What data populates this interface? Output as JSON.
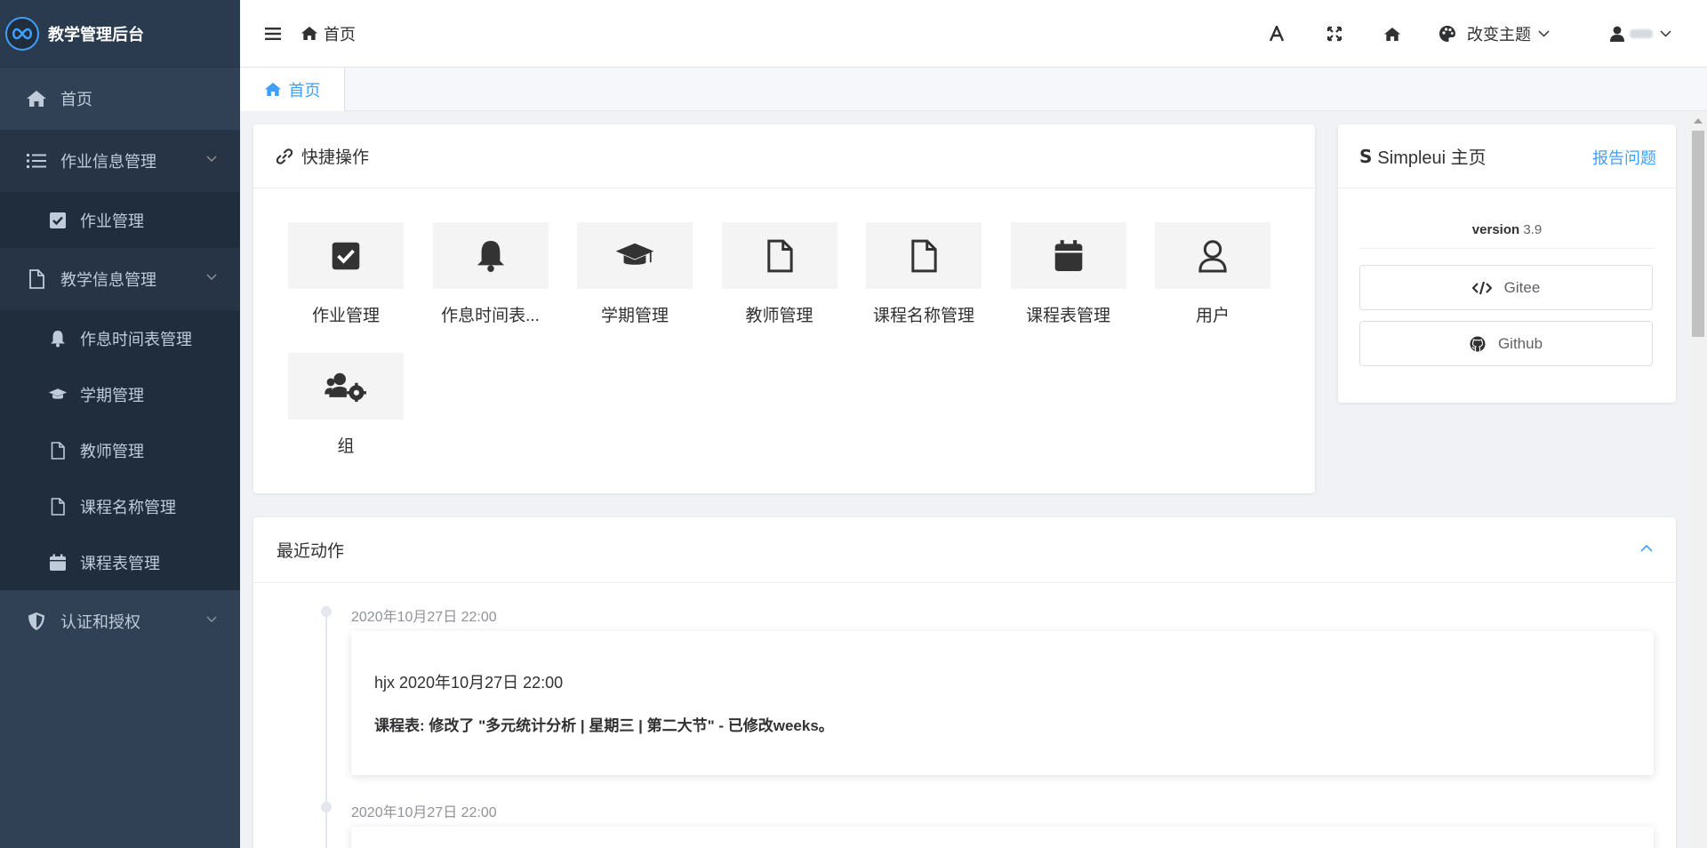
{
  "app": {
    "title": "教学管理后台",
    "brand_color": "#409eff"
  },
  "sidebar": {
    "items": [
      {
        "label": "首页",
        "icon": "home-icon"
      },
      {
        "label": "作业信息管理",
        "icon": "list-icon",
        "expanded": true,
        "children": [
          {
            "label": "作业管理",
            "icon": "check-square-icon"
          }
        ]
      },
      {
        "label": "教学信息管理",
        "icon": "file-icon",
        "expanded": true,
        "children": [
          {
            "label": "作息时间表管理",
            "icon": "bell-icon"
          },
          {
            "label": "学期管理",
            "icon": "graduation-cap-icon"
          },
          {
            "label": "教师管理",
            "icon": "file-icon"
          },
          {
            "label": "课程名称管理",
            "icon": "file-icon"
          },
          {
            "label": "课程表管理",
            "icon": "calendar-icon"
          }
        ]
      },
      {
        "label": "认证和授权",
        "icon": "shield-icon"
      }
    ]
  },
  "header": {
    "breadcrumb": "首页",
    "theme_label": "改变主题",
    "user_name": ""
  },
  "tabs": [
    {
      "label": "首页",
      "active": true
    }
  ],
  "quick": {
    "title": "快捷操作",
    "items": [
      {
        "label": "作业管理",
        "icon": "check-square-icon"
      },
      {
        "label": "作息时间表...",
        "icon": "bell-icon"
      },
      {
        "label": "学期管理",
        "icon": "graduation-cap-icon"
      },
      {
        "label": "教师管理",
        "icon": "file-icon"
      },
      {
        "label": "课程名称管理",
        "icon": "file-icon"
      },
      {
        "label": "课程表管理",
        "icon": "calendar-icon"
      },
      {
        "label": "用户",
        "icon": "user-icon"
      },
      {
        "label": "组",
        "icon": "users-cog-icon"
      }
    ]
  },
  "simpleui": {
    "title": "Simpleui 主页",
    "logo_letter": "S",
    "report_link": "报告问题",
    "version_label": "version",
    "version": "3.9",
    "links": [
      {
        "label": "Gitee",
        "icon": "code-icon"
      },
      {
        "label": "Github",
        "icon": "github-icon"
      }
    ]
  },
  "recent": {
    "title": "最近动作",
    "entries": [
      {
        "time": "2020年10月27日 22:00",
        "who": "hjx 2020年10月27日 22:00",
        "message": "课程表: 修改了 \"多元统计分析 | 星期三 | 第二大节\" - 已修改weeks。"
      },
      {
        "time": "2020年10月27日 22:00",
        "who": "",
        "message": ""
      }
    ]
  }
}
